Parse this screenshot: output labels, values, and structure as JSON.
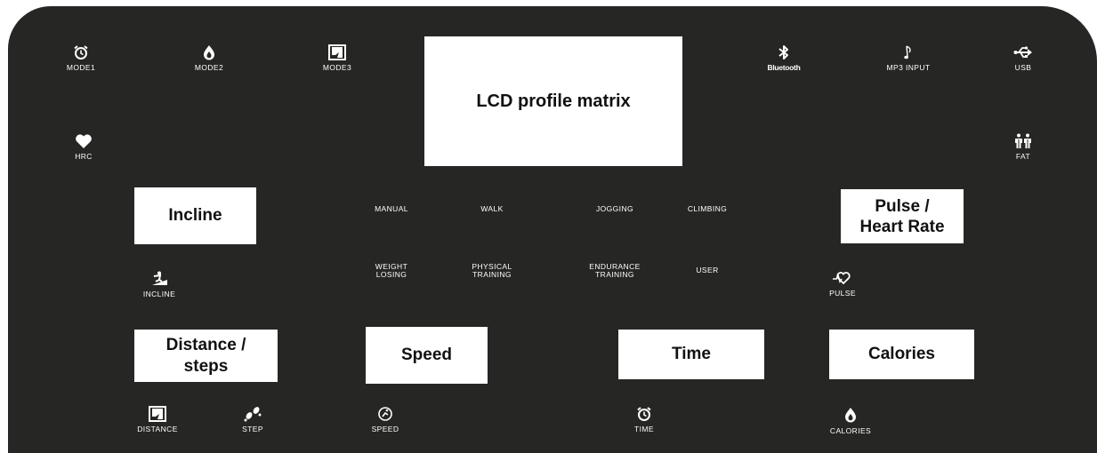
{
  "lcd": {
    "label": "LCD profile matrix"
  },
  "top_icons": {
    "mode1": "MODE1",
    "mode2": "MODE2",
    "mode3": "MODE3",
    "bluetooth": "Bluetooth",
    "mp3": "MP3 INPUT",
    "usb": "USB",
    "hrc": "HRC",
    "fat": "FAT"
  },
  "displays": {
    "incline": "Incline",
    "pulse_line1": "Pulse /",
    "pulse_line2": "Heart Rate",
    "distance_line1": "Distance /",
    "distance_line2": "steps",
    "speed": "Speed",
    "time": "Time",
    "calories": "Calories"
  },
  "programs": {
    "manual": "MANUAL",
    "walk": "WALK",
    "jogging": "JOGGING",
    "climbing": "CLIMBING",
    "weight_1": "WEIGHT",
    "weight_2": "LOSING",
    "physical_1": "PHYSICAL",
    "physical_2": "TRAINING",
    "endurance_1": "ENDURANCE",
    "endurance_2": "TRAINING",
    "user": "USER"
  },
  "indicators": {
    "incline": "INCLINE",
    "pulse": "PULSE",
    "distance": "DISTANCE",
    "step": "STEP",
    "speed": "SPEED",
    "time": "TIME",
    "calories": "CALORIES"
  },
  "icons": [
    "alarm-clock-icon",
    "flame-icon",
    "flag-icon",
    "bluetooth-icon",
    "music-note-icon",
    "usb-icon",
    "heart-icon",
    "people-icon",
    "runner-incline-icon",
    "heart-pulse-icon",
    "footsteps-icon",
    "speedometer-icon"
  ],
  "colors": {
    "panel": "#262624",
    "text": "#ffffff",
    "display_box": "#ffffff"
  }
}
